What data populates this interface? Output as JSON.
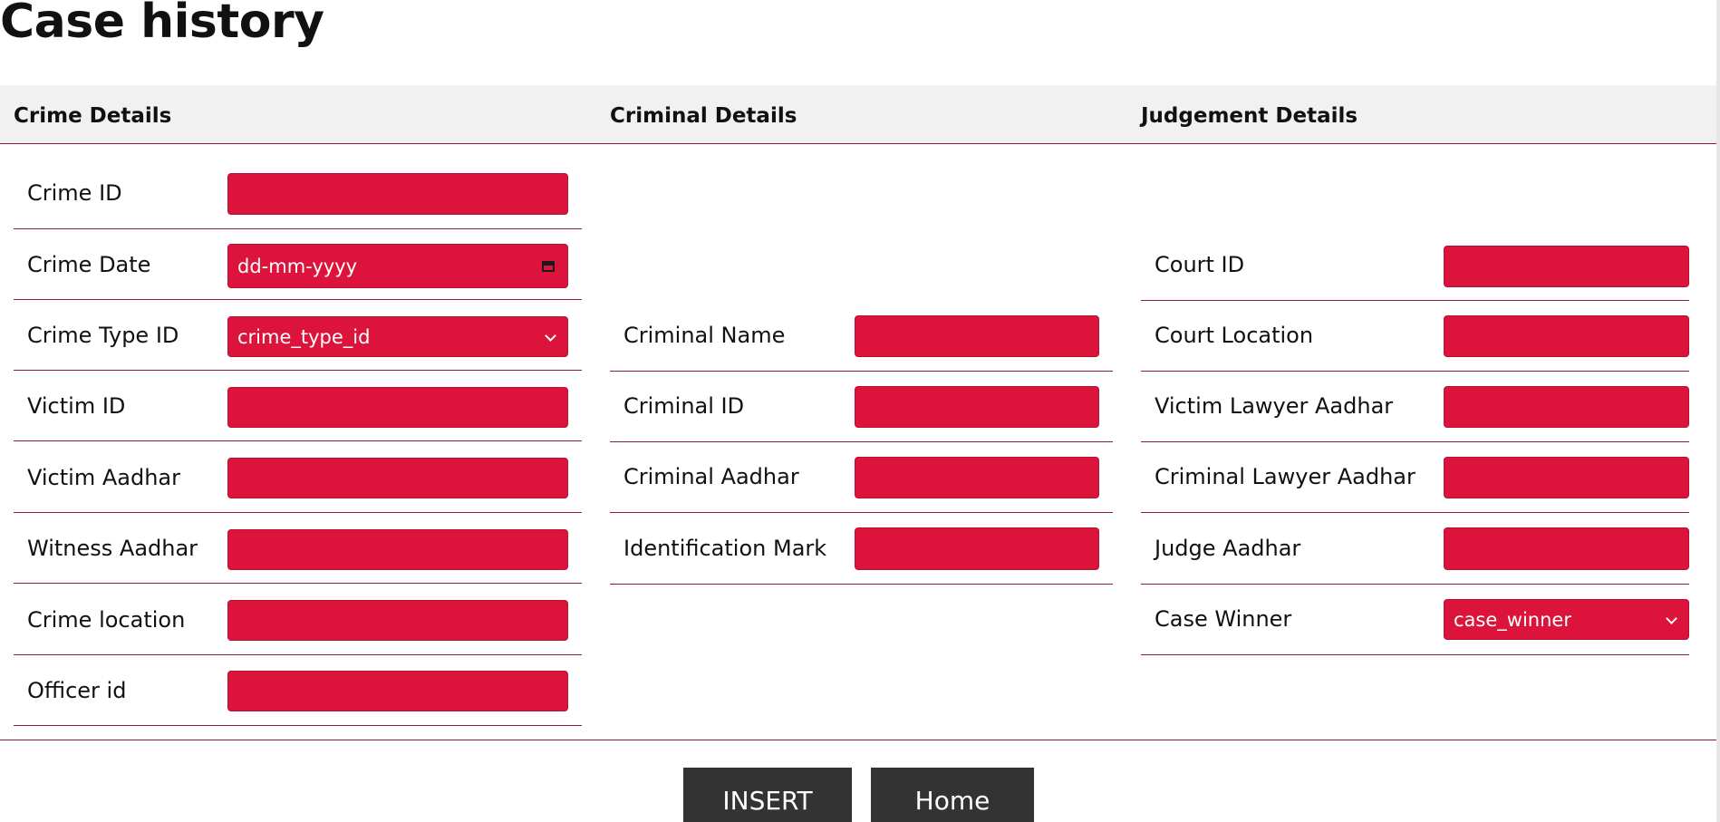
{
  "title": "Case history",
  "sections": {
    "crime": {
      "heading": "Crime Details",
      "fields": [
        {
          "label": "Crime ID",
          "value": ""
        },
        {
          "label": "Crime Date",
          "value": "dd-mm-yyyy",
          "icon": "calendar-icon"
        },
        {
          "label": "Crime Type ID",
          "value": "crime_type_id",
          "icon": "chevron-down-icon"
        },
        {
          "label": "Victim ID",
          "value": ""
        },
        {
          "label": "Victim Aadhar",
          "value": ""
        },
        {
          "label": "Witness Aadhar",
          "value": ""
        },
        {
          "label": "Crime location",
          "value": ""
        },
        {
          "label": "Officer id",
          "value": ""
        }
      ]
    },
    "criminal": {
      "heading": "Criminal Details",
      "fields": [
        {
          "label": "Criminal Name",
          "value": ""
        },
        {
          "label": "Criminal ID",
          "value": ""
        },
        {
          "label": "Criminal Aadhar",
          "value": ""
        },
        {
          "label": "Identification Mark",
          "value": ""
        }
      ]
    },
    "judgement": {
      "heading": "Judgement Details",
      "fields": [
        {
          "label": "Court ID",
          "value": ""
        },
        {
          "label": "Court Location",
          "value": ""
        },
        {
          "label": "Victim Lawyer Aadhar",
          "value": ""
        },
        {
          "label": "Criminal Lawyer Aadhar",
          "value": ""
        },
        {
          "label": "Judge Aadhar",
          "value": ""
        },
        {
          "label": "Case Winner",
          "value": "case_winner",
          "icon": "chevron-down-icon"
        }
      ]
    }
  },
  "buttons": {
    "insert": "INSERT",
    "home": "Home"
  },
  "colors": {
    "input_bg": "#dc143c",
    "divider": "#8c1d40",
    "header_band": "#f1f1f1",
    "button_bg": "#333333"
  }
}
